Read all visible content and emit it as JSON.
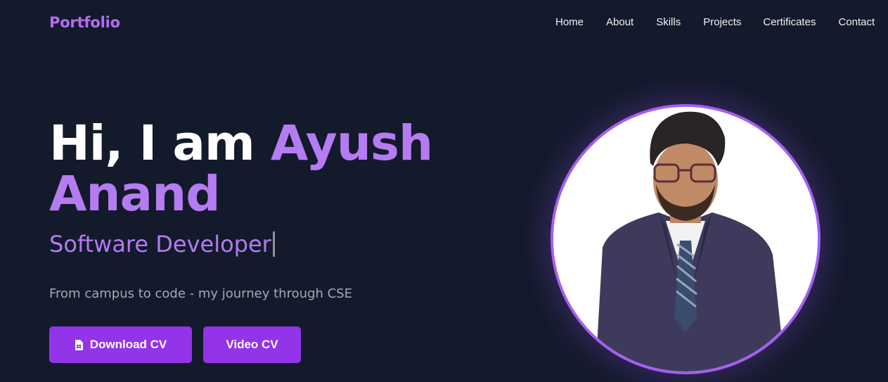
{
  "header": {
    "brand": "Portfolio",
    "nav": [
      "Home",
      "About",
      "Skills",
      "Projects",
      "Certificates",
      "Contact"
    ]
  },
  "hero": {
    "greeting": "Hi, I am",
    "first_name": "Ayush",
    "last_name": "Anand",
    "role": "Software Developer",
    "tagline": "From campus to code - my journey through CSE",
    "buttons": {
      "download_cv": "Download CV",
      "video_cv": "Video CV"
    }
  },
  "icons": {
    "download_cv_icon": "file-icon"
  },
  "colors": {
    "background": "#131a2b",
    "accent": "#b46cf2",
    "button": "#9333ea",
    "portrait_ring": "#a55ef0"
  }
}
